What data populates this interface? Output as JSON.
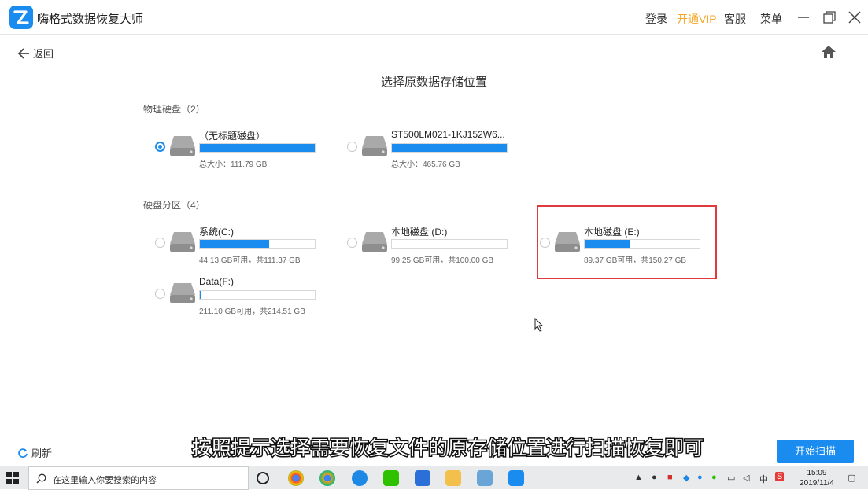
{
  "app": {
    "title": "嗨格式数据恢复大师",
    "links": {
      "login": "登录",
      "vip": "开通VIP",
      "service": "客服",
      "menu": "菜单"
    }
  },
  "nav": {
    "back_label": "返回",
    "refresh_label": "刷新"
  },
  "page": {
    "title": "选择原数据存储位置"
  },
  "physical": {
    "label": "物理硬盘（2）",
    "disks": [
      {
        "name": "（无标题磁盘）",
        "info": "总大小：111.79 GB",
        "selected": true,
        "fill": 1.0
      },
      {
        "name": "ST500LM021-1KJ152W6...",
        "info": "总大小：465.76 GB",
        "selected": false,
        "fill": 1.0
      }
    ]
  },
  "partitions": {
    "label": "硬盘分区（4）",
    "items": [
      {
        "name": "系统(C:)",
        "info": "44.13 GB可用，共111.37 GB",
        "selected": false,
        "fill": 0.6
      },
      {
        "name": "本地磁盘 (D:)",
        "info": "99.25 GB可用，共100.00 GB",
        "selected": false,
        "fill": 0.0
      },
      {
        "name": "本地磁盘 (E:)",
        "info": "89.37 GB可用，共150.27 GB",
        "selected": false,
        "fill": 0.4
      },
      {
        "name": "Data(F:)",
        "info": "211.10 GB可用，共214.51 GB",
        "selected": false,
        "fill": 0.01
      }
    ]
  },
  "subtitle": "按照提示选择需要恢复文件的原存储位置进行扫描恢复即可",
  "scan_button": "开始扫描",
  "taskbar": {
    "search_placeholder": "在这里输入你要搜索的内容",
    "ime": "中",
    "time": "15:09",
    "date": "2019/11/4"
  },
  "colors": {
    "accent": "#1a8cf0",
    "vip": "#f5a623",
    "highlight": "#e0393e"
  }
}
